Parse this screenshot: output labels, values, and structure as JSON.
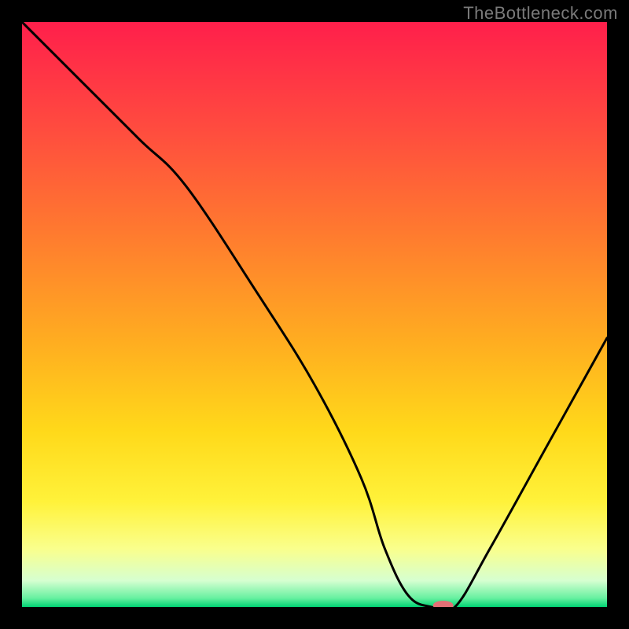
{
  "watermark": "TheBottleneck.com",
  "chart_data": {
    "type": "line",
    "title": "",
    "xlabel": "",
    "ylabel": "",
    "xlim": [
      0,
      100
    ],
    "ylim": [
      0,
      100
    ],
    "series": [
      {
        "name": "curve",
        "x": [
          0,
          10,
          20,
          28,
          40,
          50,
          58,
          62,
          66,
          70,
          74,
          80,
          90,
          100
        ],
        "y": [
          100,
          90,
          80,
          72,
          54,
          38,
          22,
          10,
          2,
          0,
          0,
          10,
          28,
          46
        ]
      }
    ],
    "marker": {
      "x": 72,
      "y": 0,
      "color": "#e37076",
      "radius_x": 13,
      "radius_y": 6
    },
    "gradient_stops": [
      {
        "offset": 0.0,
        "color": "#ff1f4b"
      },
      {
        "offset": 0.18,
        "color": "#ff4b3f"
      },
      {
        "offset": 0.36,
        "color": "#ff7a2f"
      },
      {
        "offset": 0.55,
        "color": "#ffae20"
      },
      {
        "offset": 0.7,
        "color": "#ffd91a"
      },
      {
        "offset": 0.82,
        "color": "#fff23a"
      },
      {
        "offset": 0.9,
        "color": "#faff8c"
      },
      {
        "offset": 0.955,
        "color": "#d6ffd0"
      },
      {
        "offset": 0.985,
        "color": "#66f0a0"
      },
      {
        "offset": 1.0,
        "color": "#00d373"
      }
    ]
  }
}
